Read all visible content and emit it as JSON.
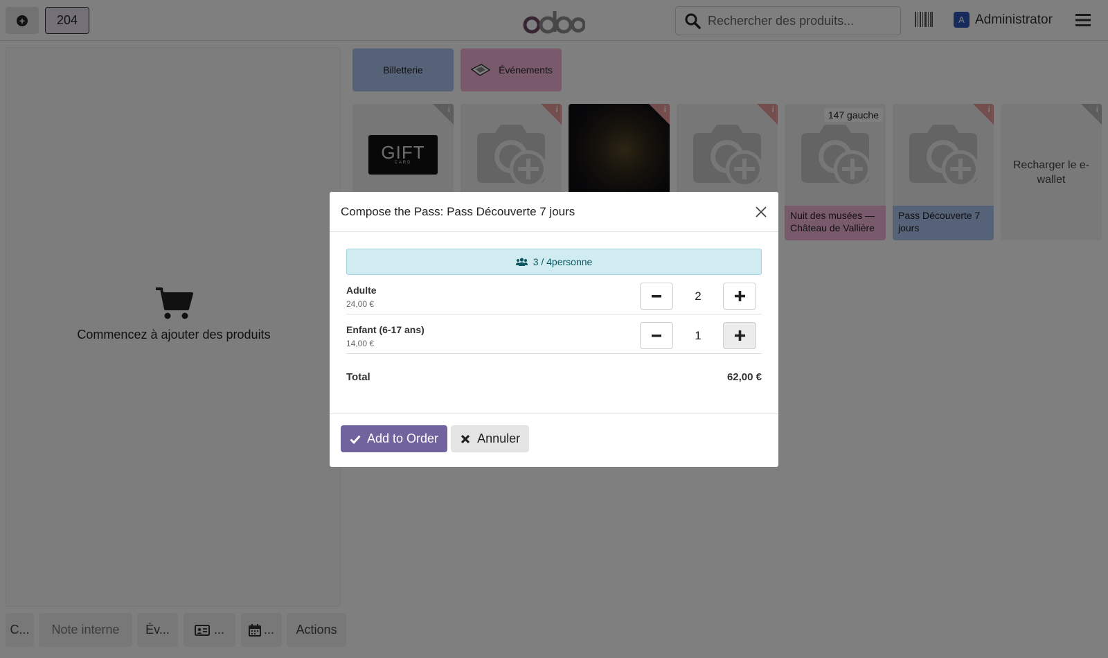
{
  "topbar": {
    "new_order_icon": "plus-circle-icon",
    "order_number": "204",
    "logo_text": "odoo",
    "search_placeholder": "Rechercher des produits...",
    "barcode_icon": "barcode-icon",
    "user_initial": "A",
    "user_name": "Administrator",
    "menu_icon": "hamburger-menu-icon"
  },
  "cart": {
    "empty_icon": "shopping-cart-icon",
    "empty_text": "Commencez à ajouter des produits"
  },
  "bottom_bar": {
    "customer": "C...",
    "internal_note": "Note interne",
    "event": "Év...",
    "contact_card": "...",
    "calendar": "...",
    "actions": "Actions"
  },
  "categories": [
    {
      "label": "Billetterie",
      "color": "#aac5ef"
    },
    {
      "label": "Événements",
      "color": "#f3b4d9"
    }
  ],
  "products": [
    {
      "name": "",
      "image": "gift-card"
    },
    {
      "name": "",
      "image": "placeholder"
    },
    {
      "name": "",
      "image": "photo"
    },
    {
      "name": "",
      "image": "placeholder"
    },
    {
      "name": "Nuit des musées — Château de Vallière",
      "badge": "147 gauche",
      "color": "#f3b4d9",
      "image": "placeholder"
    },
    {
      "name": "Pass Découverte 7 jours",
      "color": "#aac5ef",
      "image": "placeholder"
    },
    {
      "name": "Recharger le e-wallet",
      "image": "none"
    }
  ],
  "gift_card": {
    "line1": "GIFT",
    "line2": "CARD"
  },
  "modal": {
    "title": "Compose the Pass: Pass Découverte 7 jours",
    "capacity": "3 / 4personne",
    "lines": [
      {
        "name": "Adulte",
        "price": "24,00 €",
        "quantity": "2"
      },
      {
        "name": "Enfant (6-17 ans)",
        "price": "14,00 €",
        "quantity": "1"
      }
    ],
    "total_label": "Total",
    "total_value": "62,00 €",
    "add_button": "Add to Order",
    "cancel_button": "Annuler"
  },
  "colors": {
    "accent": "#71639e",
    "info_bg": "#d1ecf1",
    "info_text": "#0c5460"
  }
}
